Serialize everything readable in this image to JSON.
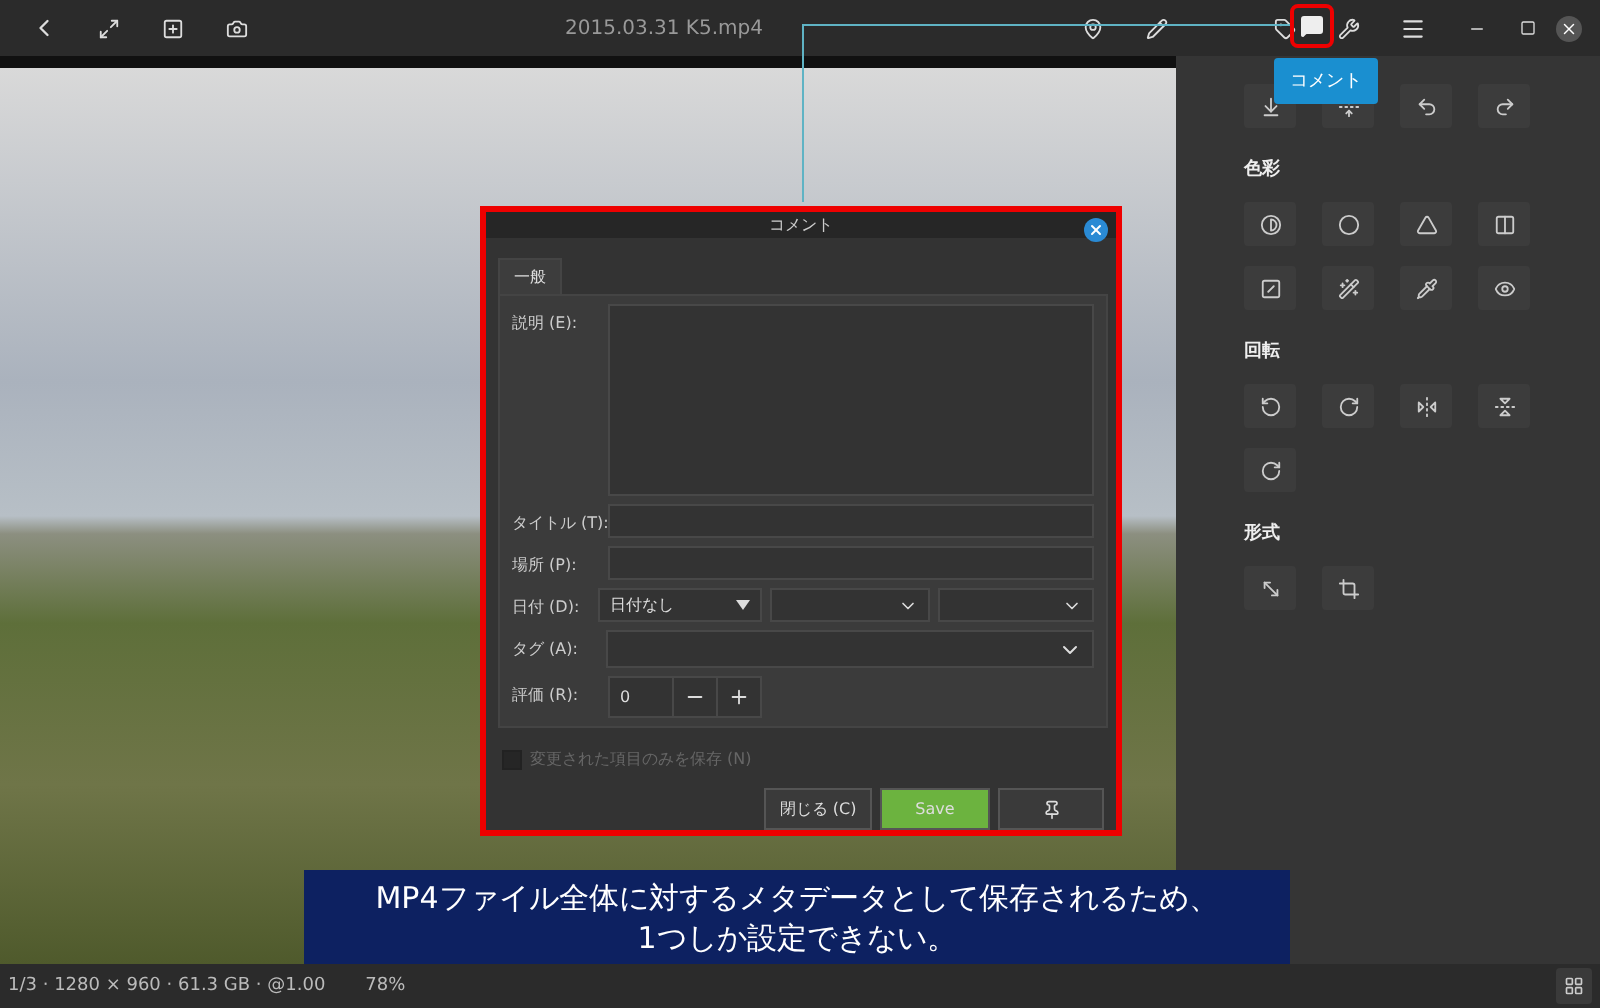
{
  "window": {
    "title": "2015.03.31 K5.mp4"
  },
  "tooltip": {
    "text": "コメント"
  },
  "side_panel": {
    "sections": [
      {
        "title": "色彩"
      },
      {
        "title": "回転"
      },
      {
        "title": "形式"
      }
    ]
  },
  "dialog": {
    "title": "コメント",
    "tabs": [
      {
        "label": "一般",
        "selected": true
      }
    ],
    "fields": [
      {
        "kind": "textarea",
        "label": "説明 (E):"
      },
      {
        "kind": "text",
        "label": "タイトル (T):"
      },
      {
        "kind": "text",
        "label": "場所 (P):"
      },
      {
        "kind": "date",
        "label": "日付 (D):",
        "value": "日付なし"
      },
      {
        "kind": "combo",
        "label": "タグ (A):"
      },
      {
        "kind": "spin",
        "label": "評価 (R):",
        "value": "0"
      }
    ],
    "checkbox": {
      "label": "変更された項目のみを保存 (N)",
      "checked": false,
      "disabled": true
    },
    "buttons": [
      {
        "kind": "plain",
        "label": "閉じる (C)"
      },
      {
        "kind": "primary",
        "label": "Save"
      },
      {
        "kind": "icon"
      }
    ]
  },
  "caption": {
    "lines": [
      "MP4ファイル全体に対するメタデータとして保存されるため、",
      "1つしか設定できない。"
    ]
  },
  "status_bar": {
    "info": "1/3 · 1280 × 960 · 61.3 GB · @1.00",
    "zoom": "78%"
  }
}
